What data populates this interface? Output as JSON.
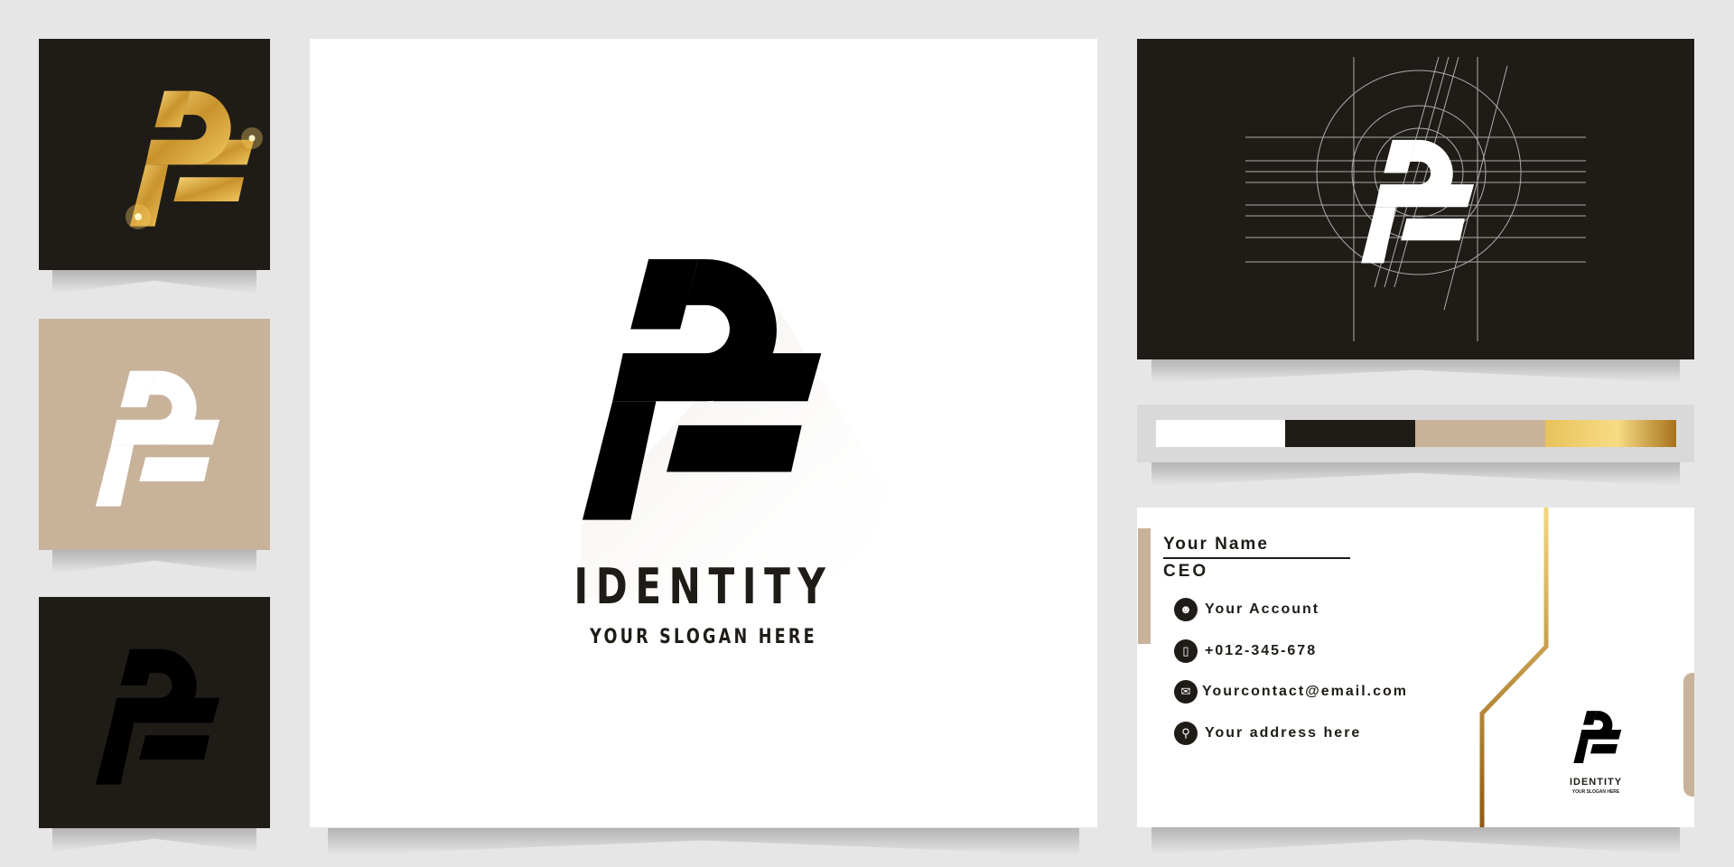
{
  "brand": {
    "name": "IDENTITY",
    "slogan": "YOUR SLOGAN HERE",
    "monogram": "P"
  },
  "colors": {
    "background": "#e6e6e6",
    "dark": "#1f1c17",
    "tan_light": "#c8b29a",
    "tan_dark": "#958370",
    "gold": "#d4a437"
  },
  "palette": [
    "#ffffff",
    "#1f1c17",
    "#c8b29a",
    "gold-gradient"
  ],
  "business_card": {
    "name": "Your Name",
    "title": "CEO",
    "contacts": [
      {
        "icon": "user-icon",
        "text": "Your Account"
      },
      {
        "icon": "phone-icon",
        "text": "+012-345-678"
      },
      {
        "icon": "mail-icon",
        "text": "Yourcontact@email.com"
      },
      {
        "icon": "location-pin-icon",
        "text": "Your address here"
      }
    ]
  }
}
